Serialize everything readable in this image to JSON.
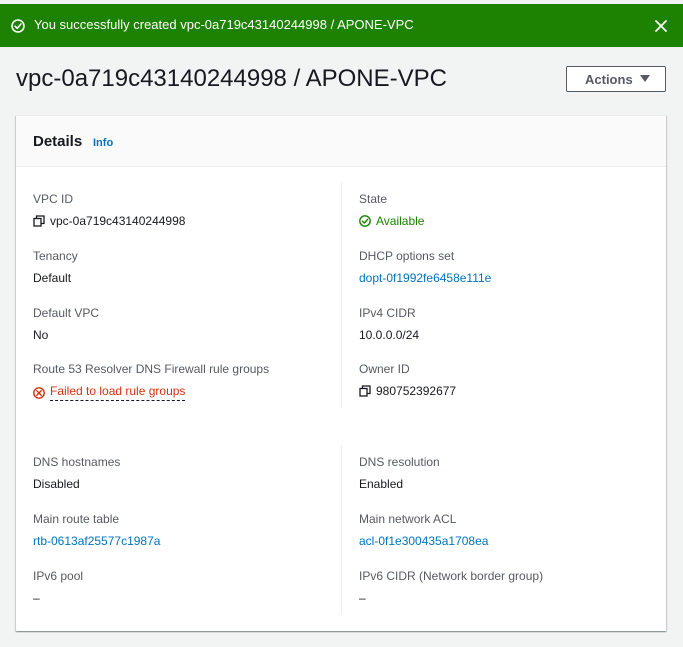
{
  "banner": {
    "message": "You successfully created vpc-0a719c43140244998 / APONE-VPC",
    "icon": "check-circle-icon",
    "close_icon": "close-icon",
    "color": "#1d8102"
  },
  "page": {
    "title": "vpc-0a719c43140244998 / APONE-VPC",
    "actions_label": "Actions"
  },
  "details": {
    "heading": "Details",
    "info_link": "Info",
    "left": [
      {
        "label": "VPC ID",
        "value": "vpc-0a719c43140244998",
        "icon": "copy-icon"
      },
      {
        "label": "Tenancy",
        "value": "Default"
      },
      {
        "label": "Default VPC",
        "value": "No"
      },
      {
        "label": "Route 53 Resolver DNS Firewall rule groups",
        "value": "Failed to load rule groups",
        "icon": "error-icon"
      },
      {
        "label": "DNS hostnames",
        "value": "Disabled"
      },
      {
        "label": "Main route table",
        "value": "rtb-0613af25577c1987a"
      },
      {
        "label": "IPv6 pool",
        "value": "–"
      }
    ],
    "right": [
      {
        "label": "State",
        "value": "Available",
        "icon": "check-circle-icon"
      },
      {
        "label": "DHCP options set",
        "value": "dopt-0f1992fe6458e111e"
      },
      {
        "label": "IPv4 CIDR",
        "value": "10.0.0.0/24"
      },
      {
        "label": "Owner ID",
        "value": "980752392677",
        "icon": "copy-icon"
      },
      {
        "label": "DNS resolution",
        "value": "Enabled"
      },
      {
        "label": "Main network ACL",
        "value": "acl-0f1e300435a1708ea"
      },
      {
        "label": "IPv6 CIDR (Network border group)",
        "value": "–"
      }
    ]
  }
}
